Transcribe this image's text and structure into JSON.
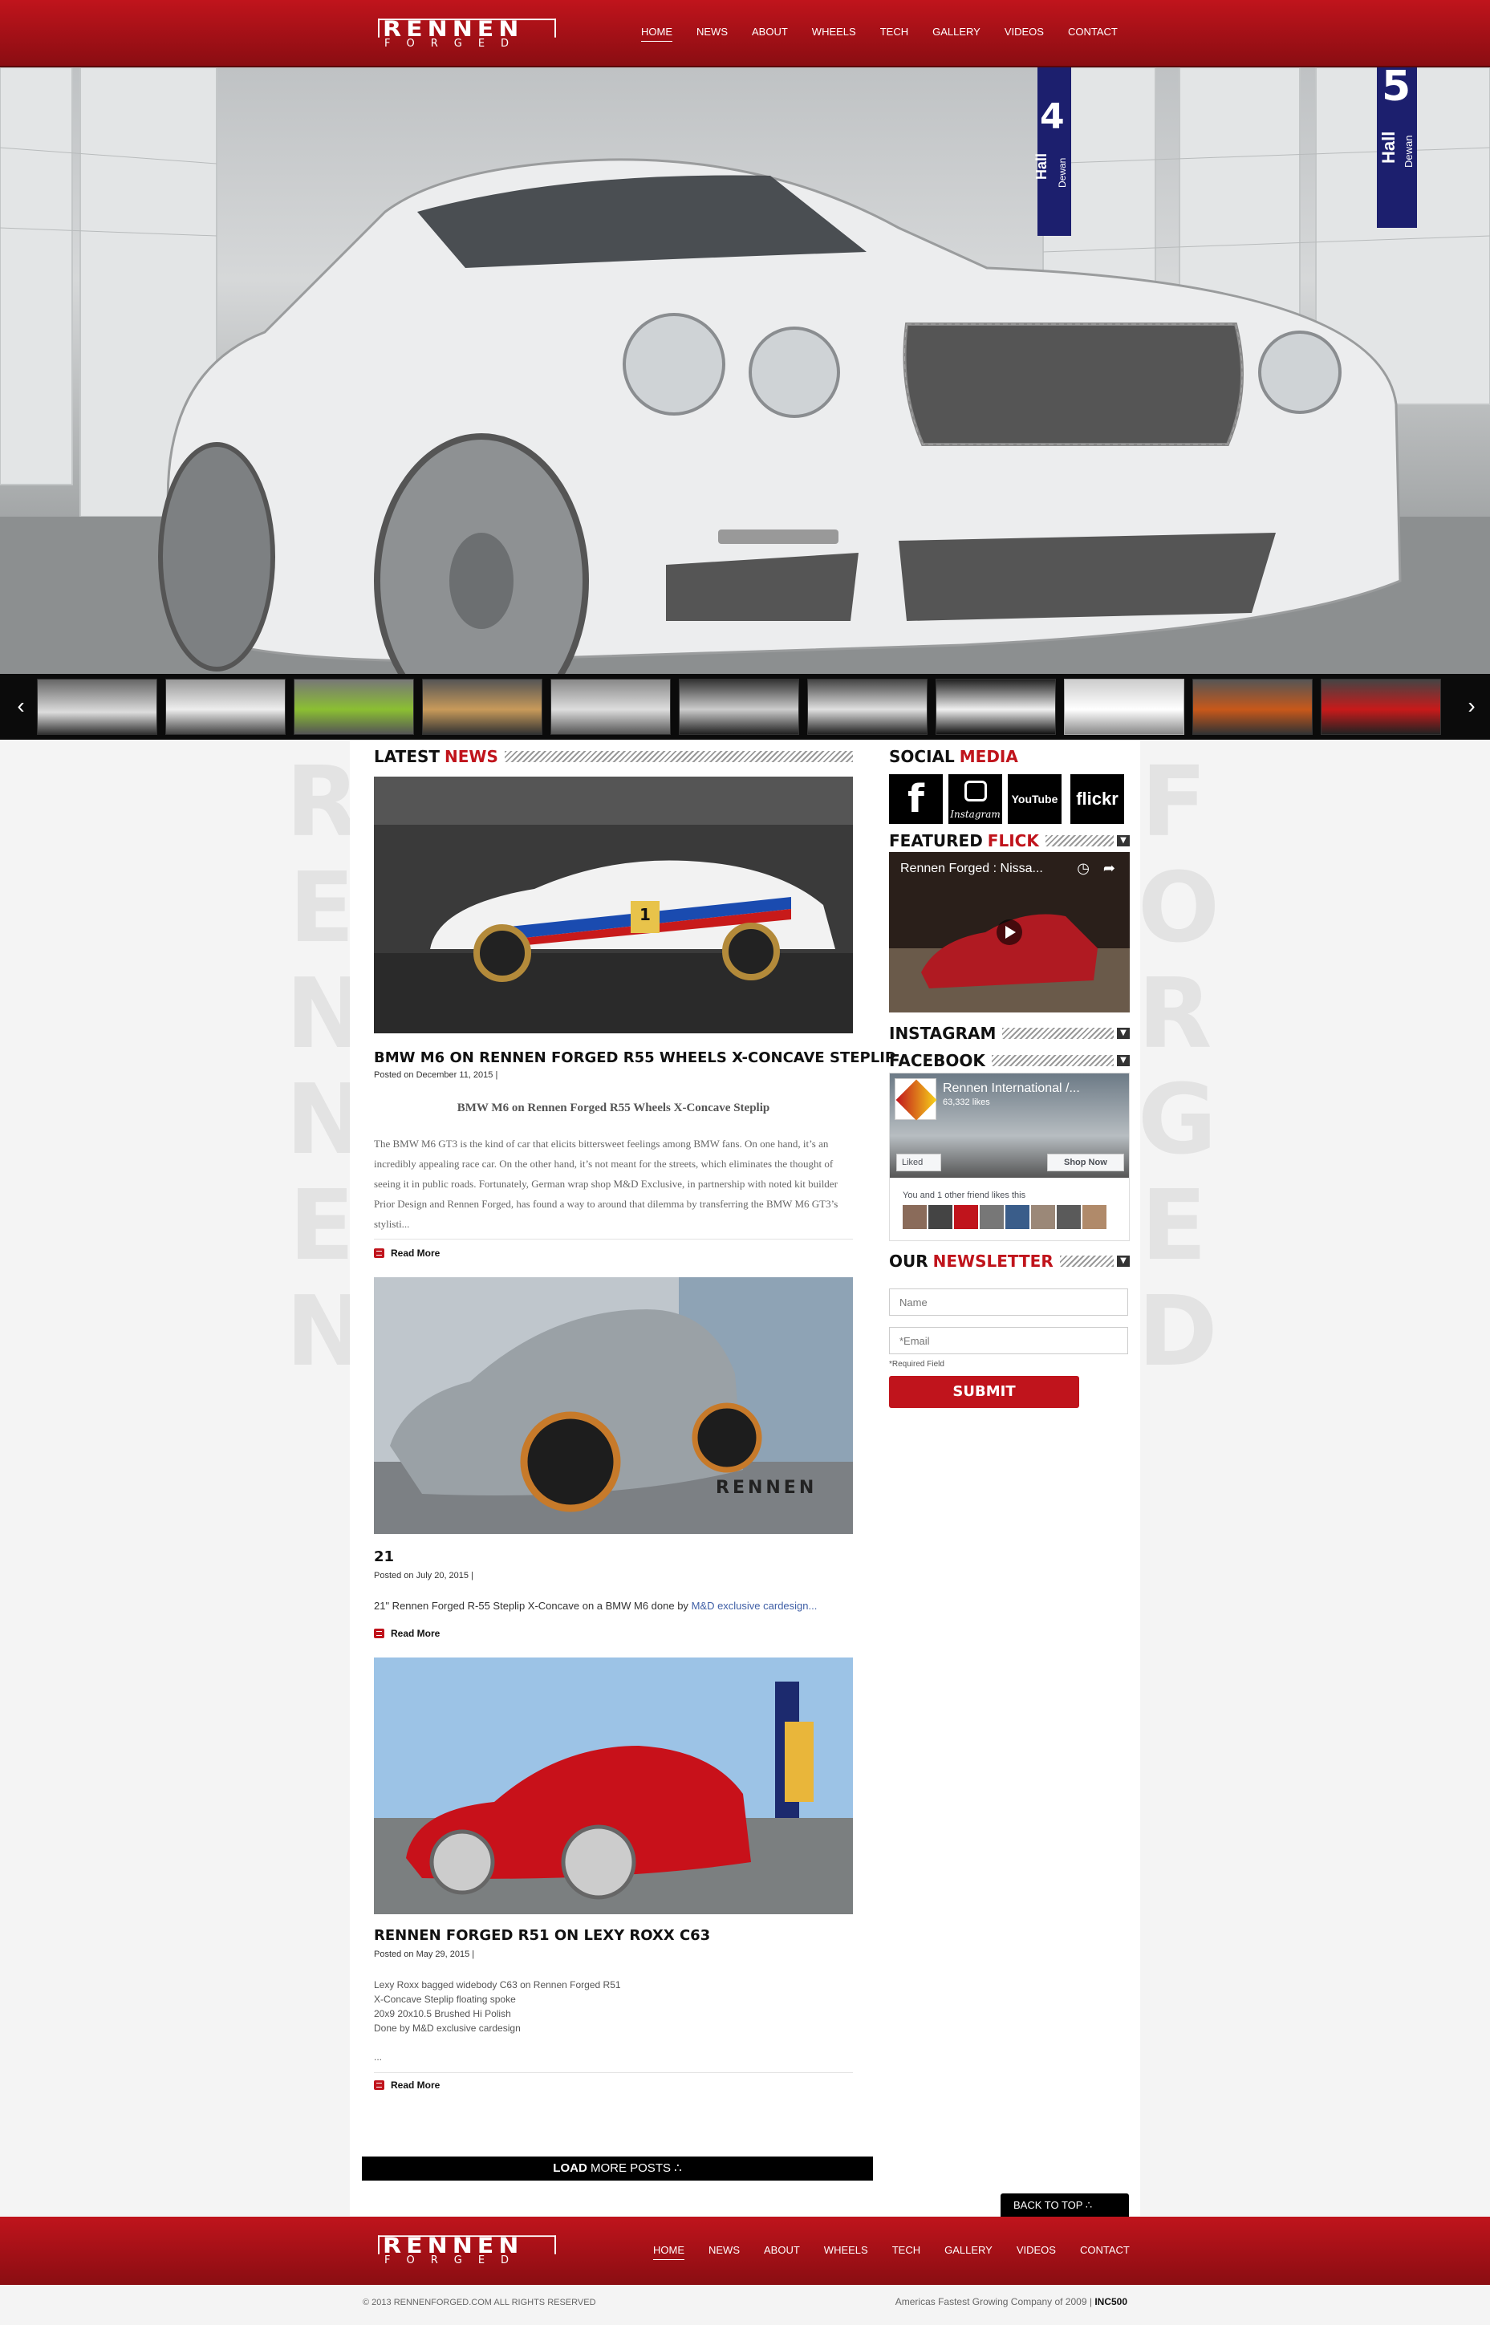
{
  "brand": {
    "logo_top": "RENNEN",
    "logo_bottom": "FORGED"
  },
  "nav": [
    "HOME",
    "NEWS",
    "ABOUT",
    "WHEELS",
    "TECH",
    "GALLERY",
    "VIDEOS",
    "CONTACT"
  ],
  "hero": {
    "sign_left_number": "4",
    "sign_left_text": "Hall",
    "sign_left_sub": "Dewan",
    "sign_right_number": "5",
    "sign_right_text": "Hall",
    "sign_right_sub": "Dewan"
  },
  "latest": {
    "title_a": "LATEST",
    "title_b": "NEWS"
  },
  "posts": [
    {
      "title": "BMW M6 ON RENNEN FORGED R55 WHEELS X-CONCAVE STEPLIP",
      "date": "Posted on December 11, 2015 |",
      "subtitle": "BMW M6 on Rennen Forged R55 Wheels X-Concave Steplip",
      "body": "The BMW M6 GT3 is the kind of car that elicits bittersweet feelings among BMW fans. On one hand, it’s an incredibly appealing race car. On the other hand, it’s not meant for the streets, which eliminates the thought of seeing it in public roads. Fortunately, German wrap shop M&D Exclusive, in partnership with noted kit builder Prior Design and Rennen Forged, has found a way to around that dilemma by transferring the BMW M6 GT3’s stylisti...",
      "read_more": "Read More",
      "plate": "1"
    },
    {
      "title": "21",
      "date": "Posted on July 20, 2015 |",
      "body_text": "21\" Rennen Forged R-55 Steplip X-Concave on a BMW M6 done by ",
      "body_link": "M&D exclusive cardesign...",
      "read_more": "Read More",
      "watermark": "RENNEN"
    },
    {
      "title": "RENNEN FORGED R51 ON LEXY ROXX C63",
      "date": "Posted on May 29, 2015 |",
      "lines": [
        "Lexy Roxx bagged widebody C63 on Rennen Forged R51",
        "X-Concave Steplip floating spoke",
        "20x9 20x10.5 Brushed Hi Polish",
        "Done by M&D exclusive cardesign"
      ],
      "ellipsis": "...",
      "read_more": "Read More"
    }
  ],
  "load_more": {
    "bold": "LOAD",
    "rest": "MORE POSTS"
  },
  "sidebar": {
    "social_title_a": "SOCIAL",
    "social_title_b": "MEDIA",
    "social": [
      "f",
      "Instagram",
      "YouTube",
      "flickr"
    ],
    "featured_a": "FEATURED",
    "featured_b": "FLICK",
    "video_title": "Rennen Forged : Nissa...",
    "instagram_title": "INSTAGRAM",
    "facebook_title": "FACEBOOK",
    "fb_page": "Rennen International /...",
    "fb_likes": "63,332 likes",
    "fb_liked": "Liked",
    "fb_shop": "Shop Now",
    "fb_friends": "You and 1 other friend likes this",
    "newsletter_a": "OUR",
    "newsletter_b": "NEWSLETTER",
    "name_placeholder": "Name",
    "email_placeholder": "*Email",
    "required": "*Required Field",
    "submit": "SUBMIT"
  },
  "back_to_top": "BACK TO TOP",
  "footer": {
    "copyright": "© 2013 RENNENFORGED.COM ALL RIGHTS RESERVED",
    "tagline": "Americas Fastest Growing Company of 2009 |",
    "tagline_bold": "INC500"
  },
  "colors": {
    "brand_red": "#c0141c",
    "dark": "#000000"
  }
}
